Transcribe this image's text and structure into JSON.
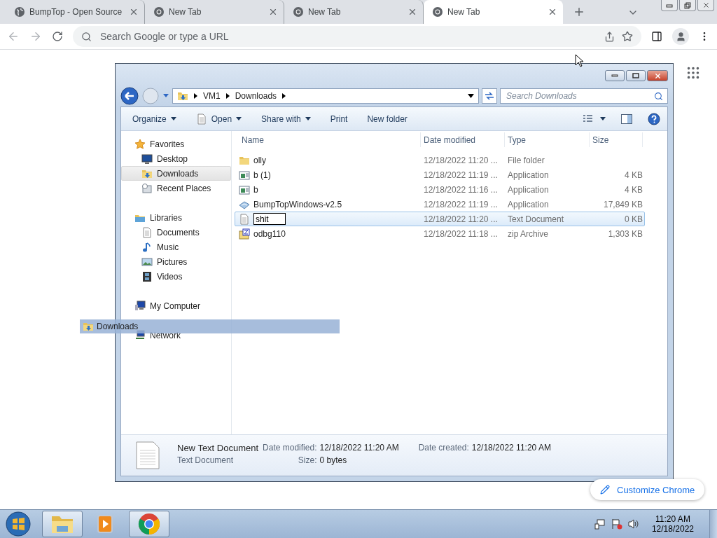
{
  "browser": {
    "tabs": [
      {
        "title": "BumpTop - Open Source",
        "kind": "globe",
        "selected": false
      },
      {
        "title": "New Tab",
        "kind": "chrome",
        "selected": false
      },
      {
        "title": "New Tab",
        "kind": "chrome",
        "selected": false
      },
      {
        "title": "New Tab",
        "kind": "chrome",
        "selected": true
      }
    ],
    "omnibox": {
      "placeholder": "Search Google or type a URL"
    },
    "customize_button": "Customize Chrome"
  },
  "explorer": {
    "breadcrumb": [
      "VM1",
      "Downloads"
    ],
    "search": {
      "placeholder": "Search Downloads"
    },
    "commands": [
      {
        "label": "Organize",
        "dropdown": true,
        "icon": false
      },
      {
        "label": "Open",
        "dropdown": true,
        "icon": true
      },
      {
        "label": "Share with",
        "dropdown": true,
        "icon": false
      },
      {
        "label": "Print",
        "dropdown": false,
        "icon": false
      },
      {
        "label": "New folder",
        "dropdown": false,
        "icon": false
      }
    ],
    "nav": [
      {
        "label": "Favorites",
        "kind": "star",
        "selected": false,
        "children": [
          {
            "label": "Desktop",
            "kind": "desktop",
            "selected": false
          },
          {
            "label": "Downloads",
            "kind": "downloads",
            "selected": true
          },
          {
            "label": "Recent Places",
            "kind": "recent",
            "selected": false
          }
        ]
      },
      {
        "label": "Libraries",
        "kind": "library",
        "selected": false,
        "children": [
          {
            "label": "Documents",
            "kind": "document",
            "selected": false
          },
          {
            "label": "Music",
            "kind": "music",
            "selected": false
          },
          {
            "label": "Pictures",
            "kind": "pictures",
            "selected": false
          },
          {
            "label": "Videos",
            "kind": "videos",
            "selected": false
          }
        ]
      },
      {
        "label": "My Computer",
        "kind": "computer",
        "selected": false
      },
      {
        "label": "Network",
        "kind": "network",
        "selected": false
      }
    ],
    "columns": [
      "Name",
      "Date modified",
      "Type",
      "Size"
    ],
    "files": [
      {
        "name": "olly",
        "date": "12/18/2022 11:20 ...",
        "type": "File folder",
        "kind": "folder",
        "selected": false,
        "editing": false
      },
      {
        "name": "b (1)",
        "date": "12/18/2022 11:19 ...",
        "type": "Application",
        "size": "4 KB",
        "kind": "app",
        "selected": false,
        "editing": false
      },
      {
        "name": "b",
        "date": "12/18/2022 11:16 ...",
        "type": "Application",
        "size": "4 KB",
        "kind": "app",
        "selected": false,
        "editing": false
      },
      {
        "name": "BumpTopWindows-v2.5",
        "date": "12/18/2022 11:19 ...",
        "type": "Application",
        "size": "17,849 KB",
        "kind": "installer",
        "selected": false,
        "editing": false
      },
      {
        "name": "shit",
        "date": "12/18/2022 11:20 ...",
        "type": "Text Document",
        "size": "0 KB",
        "kind": "text",
        "selected": true,
        "editing": true
      },
      {
        "name": "odbg110",
        "date": "12/18/2022 11:18 ...",
        "type": "zip Archive",
        "size": "1,303 KB",
        "kind": "zip",
        "selected": false,
        "editing": false
      }
    ],
    "details": {
      "name": "New Text Document",
      "type": "Text Document",
      "modified_label": "Date modified:",
      "modified": "12/18/2022 11:20 AM",
      "created_label": "Date created:",
      "created": "12/18/2022 11:20 AM",
      "size_label": "Size:",
      "size": "0 bytes"
    }
  },
  "drag_ghost": {
    "label": "Downloads"
  },
  "taskbar": {
    "apps": [
      {
        "kind": "explorer",
        "selected": true
      },
      {
        "kind": "media",
        "selected": false
      },
      {
        "kind": "chrome",
        "selected": true
      }
    ],
    "time": "11:20 AM",
    "date": "12/18/2022"
  }
}
